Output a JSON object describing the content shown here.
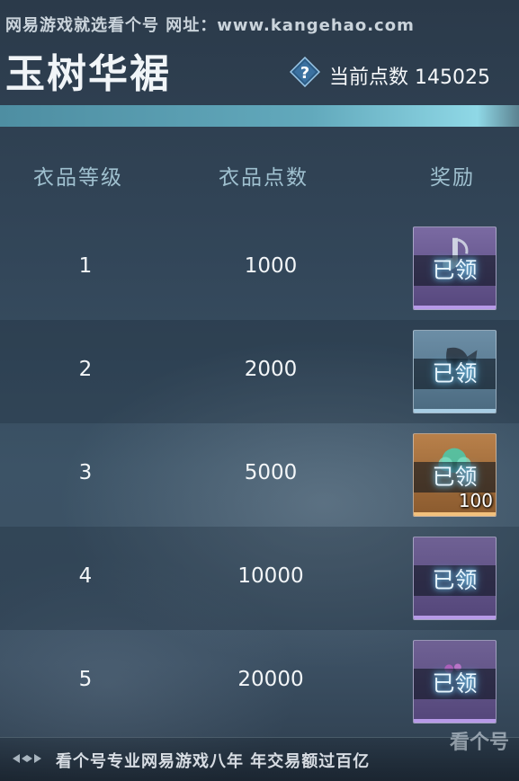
{
  "watermark": "网易游戏就选看个号   网址：www.kangehao.com",
  "title": "玉树华裾",
  "points": {
    "label": "当前点数",
    "value": "145025"
  },
  "table": {
    "headers": [
      "衣品等级",
      "衣品点数",
      "奖励"
    ],
    "rows": [
      {
        "level": "1",
        "points": "1000",
        "reward_status": "已领",
        "reward_qty": "",
        "frame_color": "#9b7fc9"
      },
      {
        "level": "2",
        "points": "2000",
        "reward_status": "已领",
        "reward_qty": "",
        "frame_color": "#8fb6cf"
      },
      {
        "level": "3",
        "points": "5000",
        "reward_status": "已领",
        "reward_qty": "100",
        "frame_color": "#e0a35a"
      },
      {
        "level": "4",
        "points": "10000",
        "reward_status": "已领",
        "reward_qty": "",
        "frame_color": "#9b7fc9"
      },
      {
        "level": "5",
        "points": "20000",
        "reward_status": "已领",
        "reward_qty": "",
        "frame_color": "#9b7fc9"
      }
    ]
  },
  "footer": "看个号专业网易游戏八年   年交易额过百亿",
  "corner_logo": "看个号",
  "icons": {
    "help": "question-diamond-icon",
    "footer_ornament": "diamond-arrow-ornament-icon"
  }
}
